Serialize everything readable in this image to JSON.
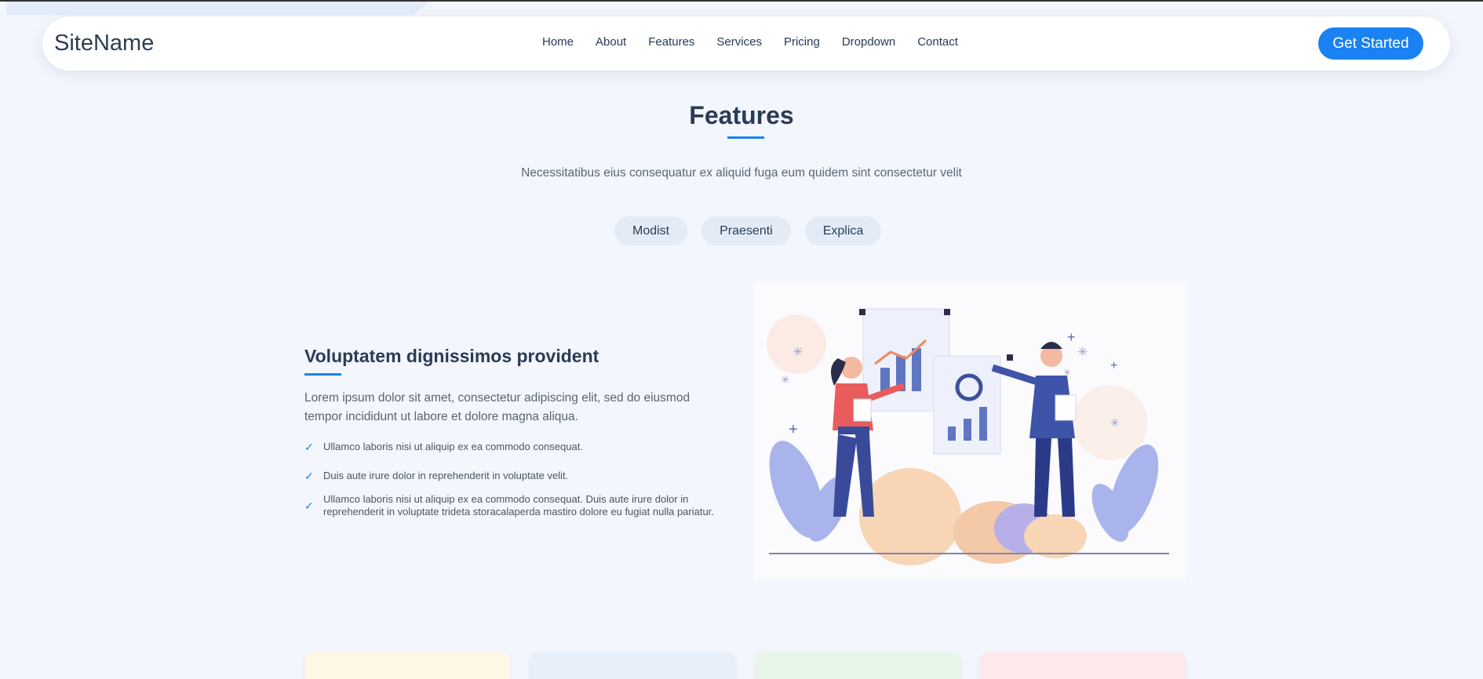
{
  "header": {
    "logo": "SiteName",
    "nav": [
      "Home",
      "About",
      "Features",
      "Services",
      "Pricing",
      "Dropdown",
      "Contact"
    ],
    "cta_label": "Get Started"
  },
  "section": {
    "title": "Features",
    "subtitle": "Necessitatibus eius consequatur ex aliquid fuga eum quidem sint consectetur velit",
    "tabs": [
      "Modist",
      "Praesenti",
      "Explica"
    ]
  },
  "feature": {
    "heading": "Voluptatem dignissimos provident",
    "description": "Lorem ipsum dolor sit amet, consectetur adipiscing elit, sed do eiusmod tempor incididunt ut labore et dolore magna aliqua.",
    "items": [
      "Ullamco laboris nisi ut aliquip ex ea commodo consequat.",
      "Duis aute irure dolor in reprehenderit in voluptate velit.",
      "Ullamco laboris nisi ut aliquip ex ea commodo consequat. Duis aute irure dolor in reprehenderit in voluptate trideta storacalaperda mastiro dolore eu fugiat nulla pariatur."
    ],
    "check_icon": "check-icon"
  },
  "colors": {
    "accent": "#1a82f2",
    "card_colors": [
      "#fff7e6",
      "#e6effa",
      "#e8f6ea",
      "#fde8ec"
    ]
  }
}
